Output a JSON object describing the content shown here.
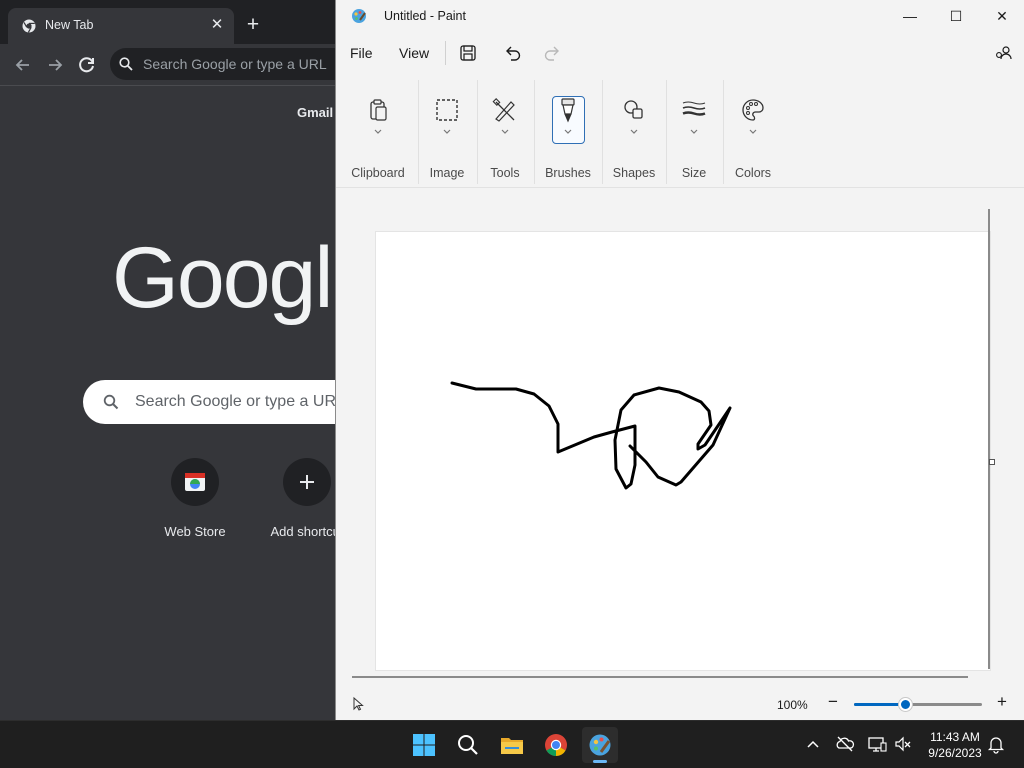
{
  "chrome": {
    "tab_title": "New Tab",
    "omnibox_placeholder": "Search Google or type a URL",
    "gmail_link": "Gmail",
    "logo_text": "Googl",
    "search_placeholder": "Search Google or type a URL",
    "shortcuts": [
      {
        "label": "Web Store",
        "icon": "web-store-icon"
      },
      {
        "label": "Add shortcut",
        "icon": "plus-icon"
      }
    ]
  },
  "paint": {
    "window_title": "Untitled - Paint",
    "menu": {
      "file": "File",
      "view": "View"
    },
    "ribbon_groups": [
      {
        "label": "Clipboard",
        "icon": "clipboard-icon"
      },
      {
        "label": "Image",
        "icon": "select-icon"
      },
      {
        "label": "Tools",
        "icon": "tools-icon"
      },
      {
        "label": "Brushes",
        "icon": "brush-icon"
      },
      {
        "label": "Shapes",
        "icon": "shapes-icon"
      },
      {
        "label": "Size",
        "icon": "size-icon"
      },
      {
        "label": "Colors",
        "icon": "palette-icon"
      }
    ],
    "selected_group": "Brushes",
    "zoom": {
      "label": "100%",
      "level": 0.4
    }
  },
  "taskbar": {
    "apps": [
      "start-icon",
      "search-icon",
      "file-explorer-icon",
      "chrome-icon",
      "paint-icon"
    ],
    "active_app": "paint-icon",
    "time": "11:43 AM",
    "date": "9/26/2023"
  },
  "colors": {
    "accent": "#0067c0",
    "chrome_dark": "#35363a",
    "taskbar": "#1f1f1f"
  }
}
